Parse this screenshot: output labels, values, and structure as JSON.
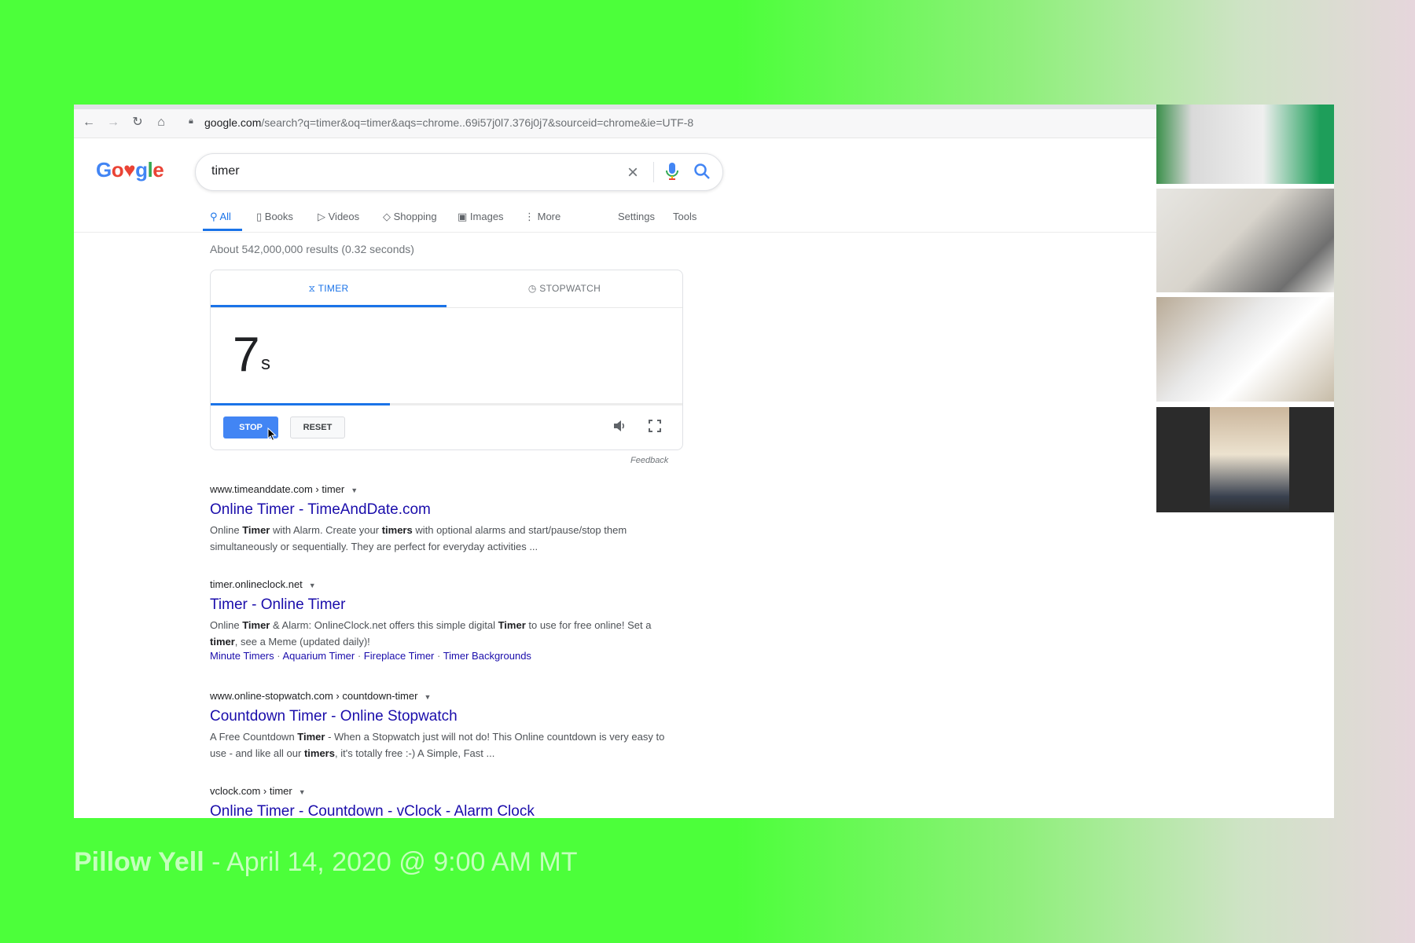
{
  "browser": {
    "url_host": "google.com",
    "url_path": "/search?q=timer&oq=timer&aqs=chrome..69i57j0l7.376j0j7&sourceid=chrome&ie=UTF-8"
  },
  "google": {
    "logo_letters": [
      "G",
      "o",
      "♥",
      "g",
      "l",
      "e"
    ],
    "logo_colors": [
      "#4285f4",
      "#ea4335",
      "#ea4335",
      "#4285f4",
      "#34a853",
      "#ea4335"
    ],
    "search_query": "timer"
  },
  "search_tabs": [
    {
      "label": "All",
      "icon": "search-icon"
    },
    {
      "label": "Books",
      "icon": "book-icon"
    },
    {
      "label": "Videos",
      "icon": "video-icon"
    },
    {
      "label": "Shopping",
      "icon": "tag-icon"
    },
    {
      "label": "Images",
      "icon": "image-icon"
    },
    {
      "label": "More",
      "icon": "kebab-icon"
    },
    {
      "label": "Settings"
    },
    {
      "label": "Tools"
    }
  ],
  "results_stats": "About 542,000,000 results (0.32 seconds)",
  "timer_widget": {
    "tab_timer": "TIMER",
    "tab_stopwatch": "STOPWATCH",
    "value": "7",
    "unit": "s",
    "progress": 0.38,
    "stop_label": "STOP",
    "reset_label": "RESET",
    "feedback": "Feedback"
  },
  "results": [
    {
      "url": "www.timeanddate.com › timer",
      "title": "Online Timer - TimeAndDate.com",
      "snippet": [
        {
          "t": "Online "
        },
        {
          "t": "Timer",
          "b": true
        },
        {
          "t": " with Alarm. Create your "
        },
        {
          "t": "timers",
          "b": true
        },
        {
          "t": " with optional alarms and start/pause/stop them simultaneously or sequentially. They are perfect for everyday activities ..."
        }
      ]
    },
    {
      "url": "timer.onlineclock.net",
      "title": "Timer - Online Timer",
      "snippet": [
        {
          "t": "Online "
        },
        {
          "t": "Timer",
          "b": true
        },
        {
          "t": " & Alarm: OnlineClock.net offers this simple digital "
        },
        {
          "t": "Timer",
          "b": true
        },
        {
          "t": " to use for free online! Set a "
        },
        {
          "t": "timer",
          "b": true
        },
        {
          "t": ", see a Meme (updated daily)!"
        }
      ],
      "sitelinks": [
        "Minute Timers",
        "Aquarium Timer",
        "Fireplace Timer",
        "Timer Backgrounds"
      ]
    },
    {
      "url": "www.online-stopwatch.com › countdown-timer",
      "title": "Countdown Timer - Online Stopwatch",
      "snippet": [
        {
          "t": "A Free Countdown "
        },
        {
          "t": "Timer",
          "b": true
        },
        {
          "t": " - When a Stopwatch just will not do! This Online countdown is very easy to use - and like all our "
        },
        {
          "t": "timers",
          "b": true
        },
        {
          "t": ", it's totally free :-) A Simple, Fast ..."
        }
      ]
    },
    {
      "url": "vclock.com › timer",
      "title": "Online Timer - Countdown - vClock - Alarm Clock",
      "snippet": []
    }
  ],
  "caption": {
    "title": "Pillow Yell",
    "separator": " - ",
    "date": "April 14, 2020 @ 9:00 AM MT"
  }
}
